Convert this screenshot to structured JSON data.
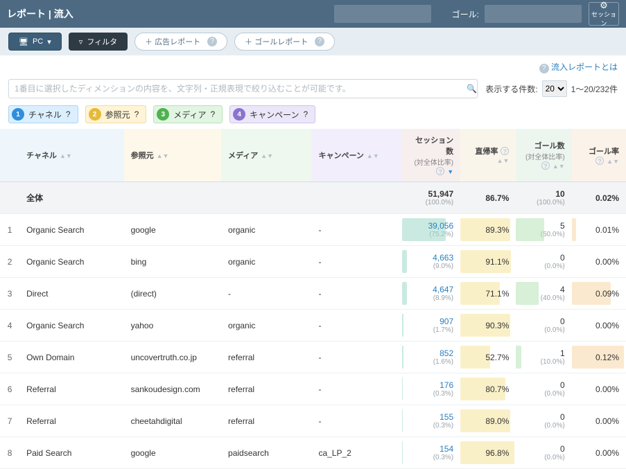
{
  "topbar": {
    "title": "レポート | 流入",
    "goal_label": "ゴール:",
    "session_btn": "セッション"
  },
  "toolbar": {
    "pc_label": "PC",
    "filter_label": "フィルタ",
    "ad_report": "＋ 広告レポート",
    "goal_report": "＋ ゴールレポート"
  },
  "help_link": "流入レポートとは",
  "filter": {
    "placeholder": "1番目に選択したディメンションの内容を、文字列・正規表現で絞り込むことが可能です。",
    "count_label": "表示する件数:",
    "count_value": "20",
    "range": "1〜20/232件"
  },
  "pills": [
    {
      "n": "1",
      "label": "チャネル"
    },
    {
      "n": "2",
      "label": "参照元"
    },
    {
      "n": "3",
      "label": "メディア"
    },
    {
      "n": "4",
      "label": "キャンペーン"
    }
  ],
  "headers": {
    "channel": "チャネル",
    "referrer": "参照元",
    "medium": "メディア",
    "campaign": "キャンペーン",
    "sessions": "セッション数",
    "sessions_sub": "(対全体比率)",
    "bounce": "直帰率",
    "goals": "ゴール数",
    "goals_sub": "(対全体比率)",
    "goal_rate": "ゴール率"
  },
  "total": {
    "label": "全体",
    "sessions": "51,947",
    "sessions_pct": "(100.0%)",
    "bounce": "86.7%",
    "goals": "10",
    "goals_pct": "(100.0%)",
    "goal_rate": "0.02%"
  },
  "rows": [
    {
      "idx": "1",
      "channel": "Organic Search",
      "referrer": "google",
      "medium": "organic",
      "campaign": "-",
      "sessions": "39,056",
      "sessions_pct": "(75.2%)",
      "sess_bar": 75,
      "bounce": "89.3%",
      "bounce_bar": 89,
      "goals": "5",
      "goals_pct": "(50.0%)",
      "goals_bar": 50,
      "goal_rate": "0.01%",
      "rate_bar": 8
    },
    {
      "idx": "2",
      "channel": "Organic Search",
      "referrer": "bing",
      "medium": "organic",
      "campaign": "-",
      "sessions": "4,663",
      "sessions_pct": "(9.0%)",
      "sess_bar": 9,
      "bounce": "91.1%",
      "bounce_bar": 91,
      "goals": "0",
      "goals_pct": "(0.0%)",
      "goals_bar": 0,
      "goal_rate": "0.00%",
      "rate_bar": 0
    },
    {
      "idx": "3",
      "channel": "Direct",
      "referrer": "(direct)",
      "medium": "-",
      "campaign": "-",
      "sessions": "4,647",
      "sessions_pct": "(8.9%)",
      "sess_bar": 9,
      "bounce": "71.1%",
      "bounce_bar": 71,
      "goals": "4",
      "goals_pct": "(40.0%)",
      "goals_bar": 40,
      "goal_rate": "0.09%",
      "rate_bar": 72
    },
    {
      "idx": "4",
      "channel": "Organic Search",
      "referrer": "yahoo",
      "medium": "organic",
      "campaign": "-",
      "sessions": "907",
      "sessions_pct": "(1.7%)",
      "sess_bar": 2,
      "bounce": "90.3%",
      "bounce_bar": 90,
      "goals": "0",
      "goals_pct": "(0.0%)",
      "goals_bar": 0,
      "goal_rate": "0.00%",
      "rate_bar": 0
    },
    {
      "idx": "5",
      "channel": "Own Domain",
      "referrer": "uncovertruth.co.jp",
      "medium": "referral",
      "campaign": "-",
      "sessions": "852",
      "sessions_pct": "(1.6%)",
      "sess_bar": 2,
      "bounce": "52.7%",
      "bounce_bar": 53,
      "goals": "1",
      "goals_pct": "(10.0%)",
      "goals_bar": 10,
      "goal_rate": "0.12%",
      "rate_bar": 96
    },
    {
      "idx": "6",
      "channel": "Referral",
      "referrer": "sankoudesign.com",
      "medium": "referral",
      "campaign": "-",
      "sessions": "176",
      "sessions_pct": "(0.3%)",
      "sess_bar": 1,
      "bounce": "80.7%",
      "bounce_bar": 81,
      "goals": "0",
      "goals_pct": "(0.0%)",
      "goals_bar": 0,
      "goal_rate": "0.00%",
      "rate_bar": 0
    },
    {
      "idx": "7",
      "channel": "Referral",
      "referrer": "cheetahdigital",
      "medium": "referral",
      "campaign": "-",
      "sessions": "155",
      "sessions_pct": "(0.3%)",
      "sess_bar": 1,
      "bounce": "89.0%",
      "bounce_bar": 89,
      "goals": "0",
      "goals_pct": "(0.0%)",
      "goals_bar": 0,
      "goal_rate": "0.00%",
      "rate_bar": 0
    },
    {
      "idx": "8",
      "channel": "Paid Search",
      "referrer": "google",
      "medium": "paidsearch",
      "campaign": "ca_LP_2",
      "sessions": "154",
      "sessions_pct": "(0.3%)",
      "sess_bar": 1,
      "bounce": "96.8%",
      "bounce_bar": 97,
      "goals": "0",
      "goals_pct": "(0.0%)",
      "goals_bar": 0,
      "goal_rate": "0.00%",
      "rate_bar": 0
    }
  ]
}
